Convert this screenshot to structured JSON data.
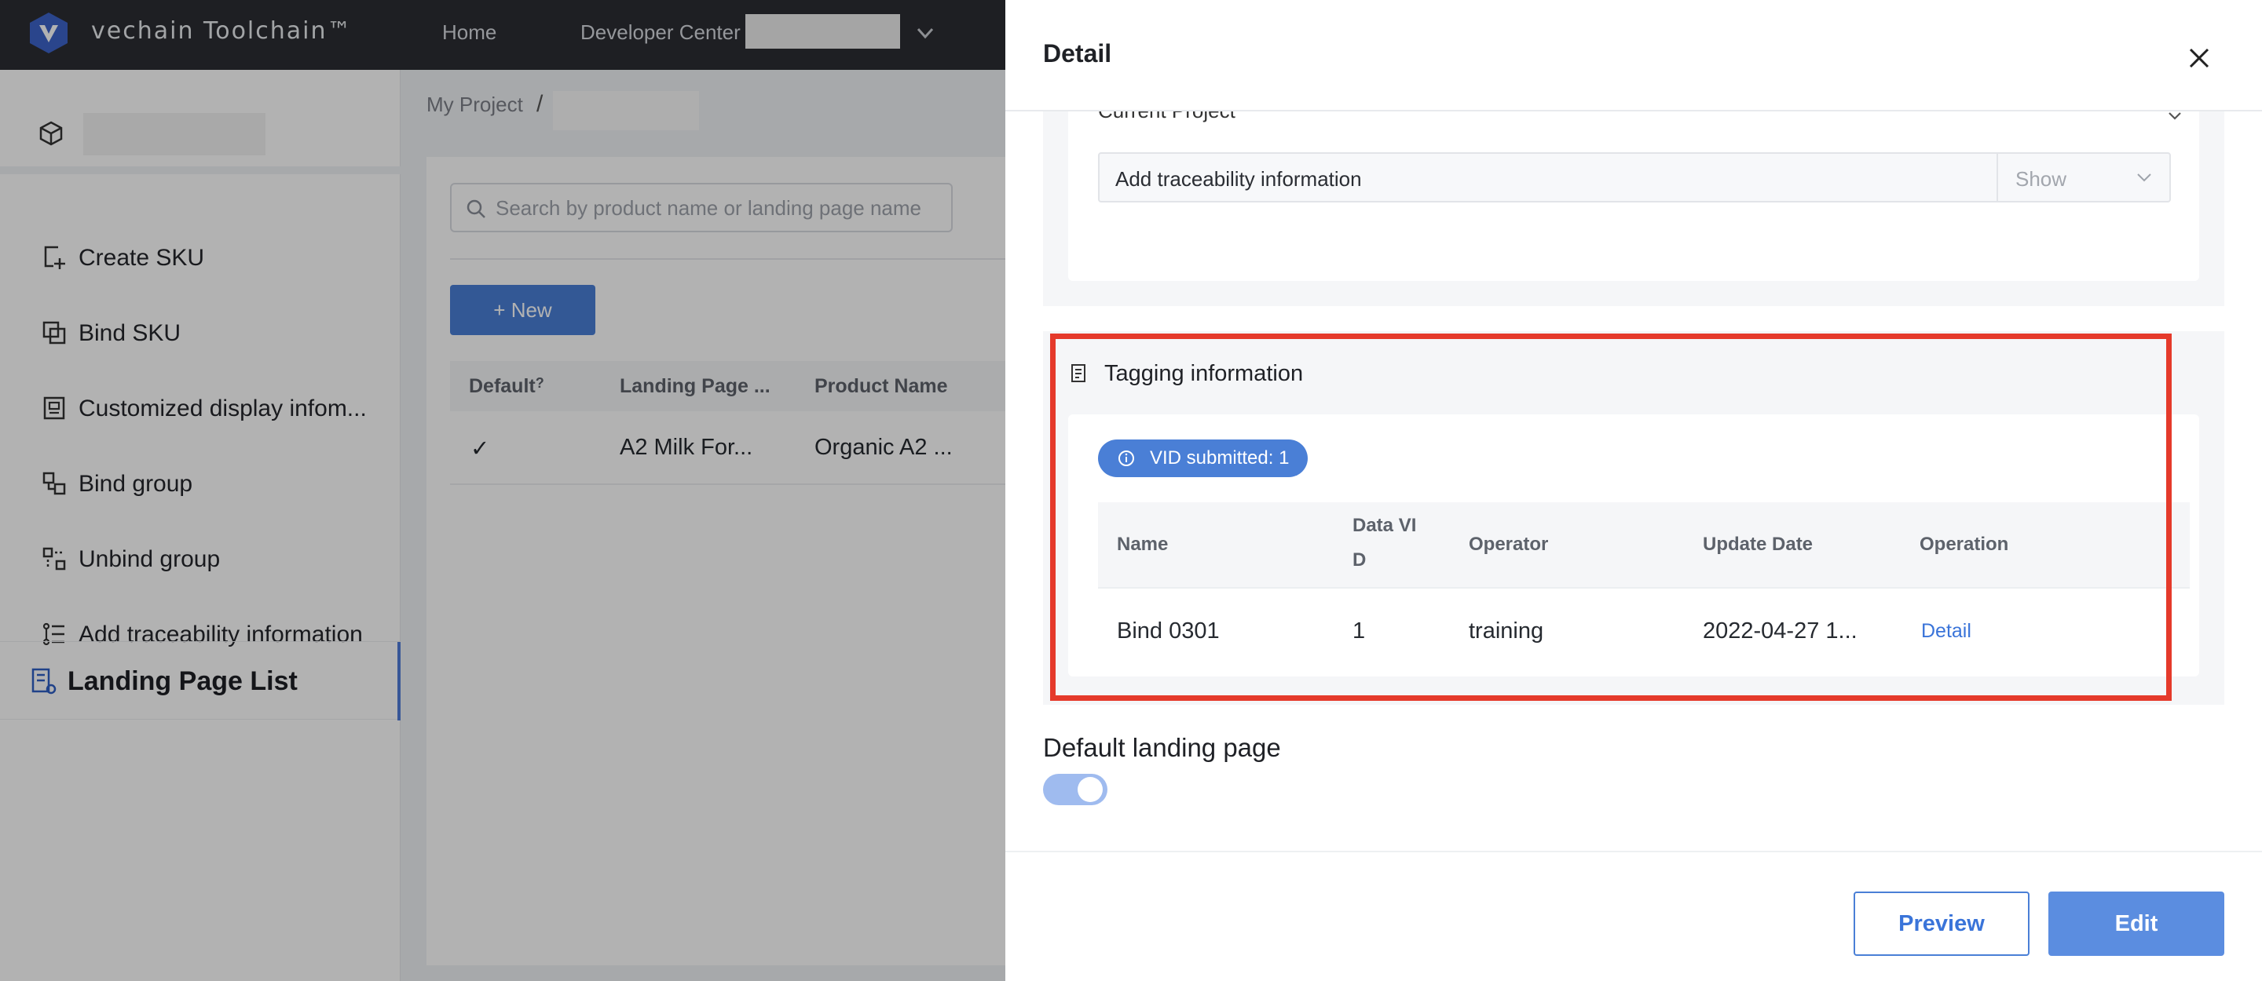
{
  "header": {
    "brand": "vechain Toolchain™",
    "nav": {
      "home": "Home",
      "developer_center": "Developer Center"
    }
  },
  "sidebar": {
    "items": [
      {
        "label": "Create SKU",
        "icon": "create-sku-icon"
      },
      {
        "label": "Bind SKU",
        "icon": "bind-sku-icon"
      },
      {
        "label": "Customized display infom...",
        "icon": "display-info-icon"
      },
      {
        "label": "Bind group",
        "icon": "bind-group-icon"
      },
      {
        "label": "Unbind group",
        "icon": "unbind-group-icon"
      },
      {
        "label": "Add traceability information",
        "icon": "traceability-list-icon"
      }
    ],
    "active_item": {
      "label": "Landing Page List",
      "icon": "landing-page-list-icon"
    }
  },
  "main": {
    "breadcrumb": "My Project",
    "breadcrumb_sep": "/",
    "search_placeholder": "Search by product name or landing page name",
    "new_button": "+ New",
    "table": {
      "headers": [
        "Default",
        "Landing Page ...",
        "Product Name"
      ],
      "rows": [
        {
          "default": "✓",
          "landing_page": "A2 Milk For...",
          "product_name": "Organic A2 ..."
        }
      ]
    }
  },
  "drawer": {
    "title": "Detail",
    "current_project": {
      "label": "Current Project",
      "trace_label": "Add traceability information",
      "trace_value": "Show"
    },
    "tagging": {
      "title": "Tagging information",
      "badge": "VID submitted: 1",
      "headers": {
        "name": "Name",
        "vid_line1": "Data VI",
        "vid_line2": "D",
        "operator": "Operator",
        "update_date": "Update Date",
        "operation": "Operation"
      },
      "rows": [
        {
          "name": "Bind 0301",
          "vid": "1",
          "operator": "training",
          "update_date": "2022-04-27 1...",
          "operation": "Detail"
        }
      ]
    },
    "default_landing_page": {
      "label": "Default landing page",
      "enabled": true
    },
    "footer": {
      "preview": "Preview",
      "edit": "Edit"
    }
  },
  "colors": {
    "header_bg": "#2b2d33",
    "primary": "#4a7fd6",
    "highlight": "#e53a2b",
    "toggle_on": "#9fbbef"
  }
}
